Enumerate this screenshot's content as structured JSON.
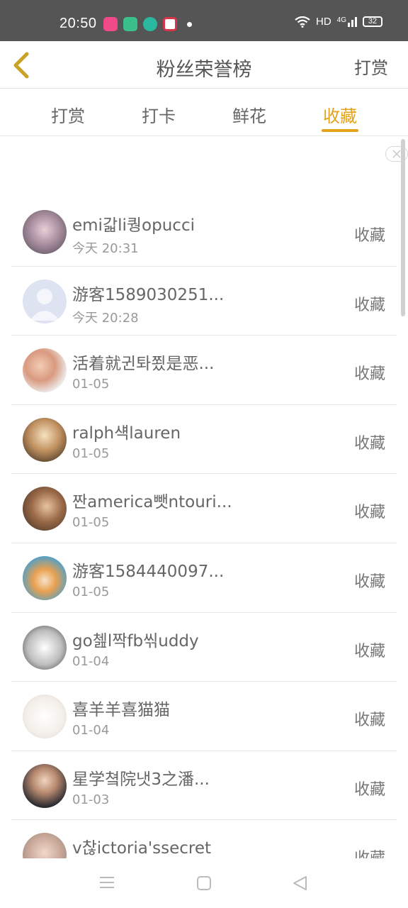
{
  "status_bar": {
    "time": "20:50",
    "network": "HD",
    "cell": "4G",
    "battery": "32"
  },
  "header": {
    "title": "粉丝荣誉榜",
    "action": "打赏"
  },
  "tabs": [
    {
      "label": "打赏"
    },
    {
      "label": "打卡"
    },
    {
      "label": "鲜花"
    },
    {
      "label": "收藏"
    }
  ],
  "active_tab": "收藏",
  "accent_color": "#e3a21a",
  "fans": [
    {
      "name": "emi갋li퀑opucci",
      "time": "今天 20:31",
      "action": "收藏"
    },
    {
      "name": "游客1589030251...",
      "time": "今天 20:28",
      "action": "收藏"
    },
    {
      "name": "活着就귄톼쬤是恶...",
      "time": "01-05",
      "action": "收藏"
    },
    {
      "name": "ralph섁lauren",
      "time": "01-05",
      "action": "收藏"
    },
    {
      "name": "짠america뺏ntouri...",
      "time": "01-05",
      "action": "收藏"
    },
    {
      "name": "游客1584440097...",
      "time": "01-05",
      "action": "收藏"
    },
    {
      "name": "go쳂l짝fb씪uddy",
      "time": "01-04",
      "action": "收藏"
    },
    {
      "name": "喜羊羊喜猫猫",
      "time": "01-04",
      "action": "收藏"
    },
    {
      "name": "星学쳨院냇3之潘...",
      "time": "01-03",
      "action": "收藏"
    },
    {
      "name": "v찮ictoria'ssecret",
      "time": "",
      "action": "收藏"
    }
  ]
}
